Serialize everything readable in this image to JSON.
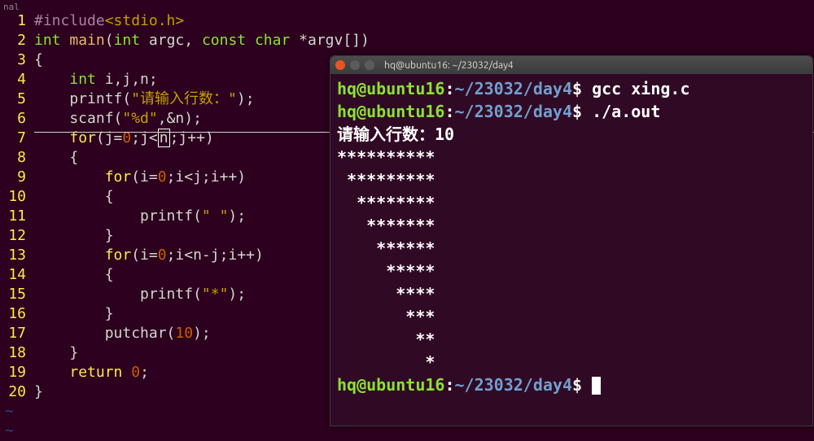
{
  "editor": {
    "title": "nal",
    "lines": [
      {
        "num": "1",
        "tokens": [
          {
            "cls": "preproc",
            "t": "#include"
          },
          {
            "cls": "angle",
            "t": "<stdio.h>"
          }
        ]
      },
      {
        "num": "2",
        "tokens": [
          {
            "cls": "type",
            "t": "int"
          },
          {
            "cls": "punct",
            "t": " "
          },
          {
            "cls": "func",
            "t": "main"
          },
          {
            "cls": "punct",
            "t": "("
          },
          {
            "cls": "type",
            "t": "int"
          },
          {
            "cls": "punct",
            "t": " argc, "
          },
          {
            "cls": "type",
            "t": "const"
          },
          {
            "cls": "punct",
            "t": " "
          },
          {
            "cls": "type",
            "t": "char"
          },
          {
            "cls": "punct",
            "t": " *argv[])"
          }
        ]
      },
      {
        "num": "3",
        "tokens": [
          {
            "cls": "punct",
            "t": "{"
          }
        ]
      },
      {
        "num": "4",
        "tokens": [
          {
            "cls": "punct",
            "t": "    "
          },
          {
            "cls": "type",
            "t": "int"
          },
          {
            "cls": "punct",
            "t": " i,j,n;"
          }
        ]
      },
      {
        "num": "5",
        "tokens": [
          {
            "cls": "punct",
            "t": "    printf("
          },
          {
            "cls": "string",
            "t": "\"请输入行数：\""
          },
          {
            "cls": "punct",
            "t": ");"
          }
        ]
      },
      {
        "num": "6",
        "tokens": [
          {
            "cls": "punct",
            "t": "    scanf("
          },
          {
            "cls": "string",
            "t": "\"%d\""
          },
          {
            "cls": "punct",
            "t": ",&n);"
          }
        ]
      },
      {
        "num": "7",
        "tokens": [
          {
            "cls": "punct",
            "t": "    "
          },
          {
            "cls": "keyword",
            "t": "for"
          },
          {
            "cls": "punct",
            "t": "(j="
          },
          {
            "cls": "number",
            "t": "0"
          },
          {
            "cls": "punct",
            "t": ";j<"
          },
          {
            "cls": "cursor-box",
            "t": "n"
          },
          {
            "cls": "punct",
            "t": ";j++)"
          }
        ]
      },
      {
        "num": "8",
        "tokens": [
          {
            "cls": "punct",
            "t": "    {"
          }
        ]
      },
      {
        "num": "9",
        "tokens": [
          {
            "cls": "punct",
            "t": "        "
          },
          {
            "cls": "keyword",
            "t": "for"
          },
          {
            "cls": "punct",
            "t": "(i="
          },
          {
            "cls": "number",
            "t": "0"
          },
          {
            "cls": "punct",
            "t": ";i<j;i++)"
          }
        ]
      },
      {
        "num": "10",
        "tokens": [
          {
            "cls": "punct",
            "t": "        {"
          }
        ]
      },
      {
        "num": "11",
        "tokens": [
          {
            "cls": "punct",
            "t": "            printf("
          },
          {
            "cls": "string",
            "t": "\" \""
          },
          {
            "cls": "punct",
            "t": ");"
          }
        ]
      },
      {
        "num": "12",
        "tokens": [
          {
            "cls": "punct",
            "t": "        }"
          }
        ]
      },
      {
        "num": "13",
        "tokens": [
          {
            "cls": "punct",
            "t": "        "
          },
          {
            "cls": "keyword",
            "t": "for"
          },
          {
            "cls": "punct",
            "t": "(i="
          },
          {
            "cls": "number",
            "t": "0"
          },
          {
            "cls": "punct",
            "t": ";i<n-j;i++)"
          }
        ]
      },
      {
        "num": "14",
        "tokens": [
          {
            "cls": "punct",
            "t": "        {"
          }
        ]
      },
      {
        "num": "15",
        "tokens": [
          {
            "cls": "punct",
            "t": "            printf("
          },
          {
            "cls": "string",
            "t": "\"*\""
          },
          {
            "cls": "punct",
            "t": ");"
          }
        ]
      },
      {
        "num": "16",
        "tokens": [
          {
            "cls": "punct",
            "t": "        }"
          }
        ]
      },
      {
        "num": "17",
        "tokens": [
          {
            "cls": "punct",
            "t": "        putchar("
          },
          {
            "cls": "number",
            "t": "10"
          },
          {
            "cls": "punct",
            "t": ");"
          }
        ]
      },
      {
        "num": "18",
        "tokens": [
          {
            "cls": "punct",
            "t": "    }"
          }
        ]
      },
      {
        "num": "19",
        "tokens": [
          {
            "cls": "punct",
            "t": "    "
          },
          {
            "cls": "keyword",
            "t": "return"
          },
          {
            "cls": "punct",
            "t": " "
          },
          {
            "cls": "number",
            "t": "0"
          },
          {
            "cls": "punct",
            "t": ";"
          }
        ]
      },
      {
        "num": "20",
        "tokens": [
          {
            "cls": "punct",
            "t": "}"
          }
        ]
      }
    ],
    "tildes": [
      "~",
      "~"
    ]
  },
  "terminal": {
    "title": "hq@ubuntu16: ~/23032/day4",
    "prompts": [
      {
        "user": "hq@ubuntu16",
        "sep": ":",
        "path": "~/23032/day4",
        "dollar": "$",
        "cmd": " gcc xing.c"
      },
      {
        "user": "hq@ubuntu16",
        "sep": ":",
        "path": "~/23032/day4",
        "dollar": "$",
        "cmd": " ./a.out"
      }
    ],
    "output": [
      "请输入行数：10",
      "**********",
      " *********",
      "  ********",
      "   *******",
      "    ******",
      "     *****",
      "      ****",
      "       ***",
      "        **",
      "         *"
    ],
    "final_prompt": {
      "user": "hq@ubuntu16",
      "sep": ":",
      "path": "~/23032/day4",
      "dollar": "$",
      "cmd": " "
    }
  }
}
